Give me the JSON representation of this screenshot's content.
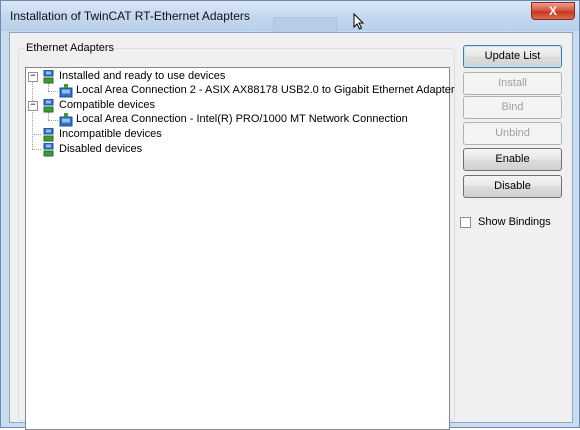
{
  "window": {
    "title": "Installation of TwinCAT RT-Ethernet Adapters",
    "close_label": "X"
  },
  "group": {
    "label": "Ethernet Adapters"
  },
  "tree": {
    "installed_label": "Installed and ready to use devices",
    "installed_child": "Local Area Connection 2 - ASIX AX88178 USB2.0 to Gigabit Ethernet Adapter",
    "compatible_label": "Compatible devices",
    "compatible_child": "Local Area Connection - Intel(R) PRO/1000 MT Network Connection",
    "incompatible_label": "Incompatible devices",
    "disabled_label": "Disabled devices",
    "collapse_glyph": "−"
  },
  "buttons": {
    "update_list": "Update List",
    "install": "Install",
    "bind": "Bind",
    "unbind": "Unbind",
    "enable": "Enable",
    "disable": "Disable"
  },
  "options": {
    "show_bindings_label": "Show Bindings",
    "show_bindings_checked": false
  },
  "colors": {
    "title_bar": "#c5d8ef",
    "close_button": "#d9583f",
    "icon_blue": "#2f6fc4",
    "icon_green": "#3d9b35"
  }
}
